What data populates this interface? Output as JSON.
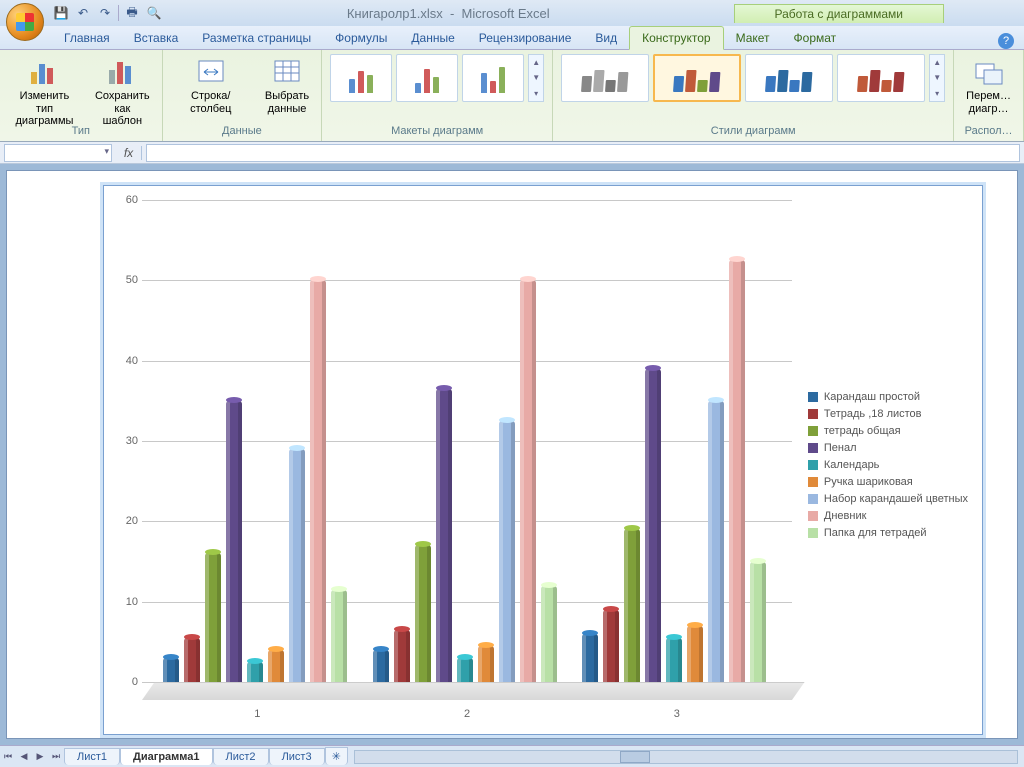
{
  "title": {
    "doc": "Книгаролр1.xlsx",
    "app": "Microsoft Excel",
    "context_tab": "Работа с диаграммами"
  },
  "qat": {
    "save": "💾",
    "undo": "↶",
    "redo": "↷",
    "print": "🖶",
    "preview": "🔍"
  },
  "tabs": {
    "home": "Главная",
    "insert": "Вставка",
    "layout": "Разметка страницы",
    "formulas": "Формулы",
    "data": "Данные",
    "review": "Рецензирование",
    "view": "Вид",
    "design": "Конструктор",
    "layout2": "Макет",
    "format": "Формат"
  },
  "ribbon": {
    "type_group": "Тип",
    "change_type": "Изменить тип\nдиаграммы",
    "save_template": "Сохранить\nкак шаблон",
    "data_group": "Данные",
    "switch_rc": "Строка/столбец",
    "select_data": "Выбрать\nданные",
    "layouts_group": "Макеты диаграмм",
    "styles_group": "Стили диаграмм",
    "loc_group": "Распол…",
    "move": "Перем…\nдиагр…"
  },
  "formula_bar": {
    "name": "",
    "fx": "fx"
  },
  "sheets": {
    "s1": "Лист1",
    "chart": "Диаграмма1",
    "s2": "Лист2",
    "s3": "Лист3"
  },
  "chart_data": {
    "type": "bar",
    "categories": [
      "1",
      "2",
      "3"
    ],
    "series": [
      {
        "name": "Карандаш простой",
        "color": "#2c6aa0",
        "values": [
          3,
          4,
          6
        ]
      },
      {
        "name": "Тетрадь ,18 листов",
        "color": "#a03a3a",
        "values": [
          5.5,
          6.5,
          9
        ]
      },
      {
        "name": "тетрадь общая",
        "color": "#7fa03a",
        "values": [
          16,
          17,
          19
        ]
      },
      {
        "name": "Пенал",
        "color": "#5f4a8a",
        "values": [
          35,
          36.5,
          39
        ]
      },
      {
        "name": "Календарь",
        "color": "#2fa0aa",
        "values": [
          2.5,
          3,
          5.5
        ]
      },
      {
        "name": "Ручка шариковая",
        "color": "#e08a3a",
        "values": [
          4,
          4.5,
          7
        ]
      },
      {
        "name": "Набор карандашей цветных",
        "color": "#9ab8e0",
        "values": [
          29,
          32.5,
          35
        ]
      },
      {
        "name": "Дневник",
        "color": "#e8aaa6",
        "values": [
          50,
          50,
          52.5
        ]
      },
      {
        "name": "Папка для тетрадей",
        "color": "#b8e0a6",
        "values": [
          11.5,
          12,
          15
        ]
      }
    ],
    "ylim": [
      0,
      60
    ],
    "yticks": [
      0,
      10,
      20,
      30,
      40,
      50,
      60
    ],
    "text_color": "#595959"
  }
}
